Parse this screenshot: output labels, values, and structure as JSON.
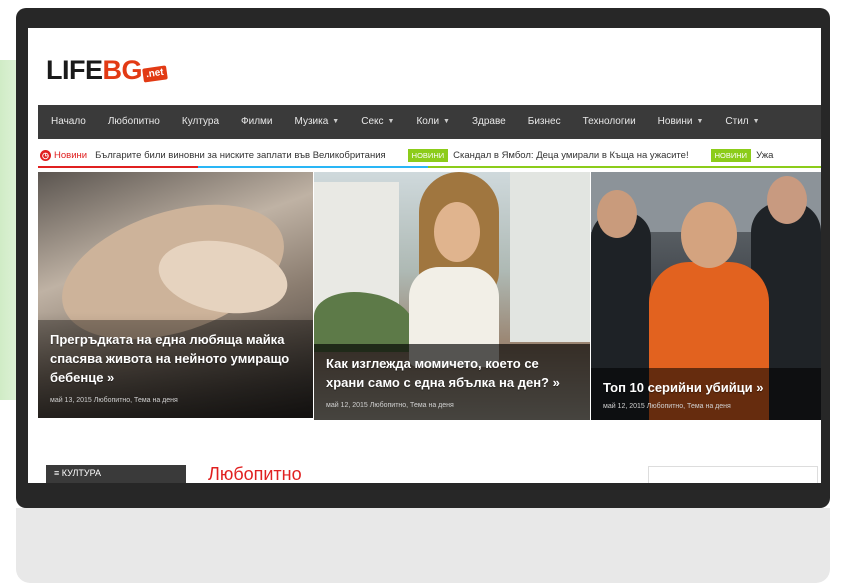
{
  "site": {
    "logo_main": "LIFE",
    "logo_accent": "BG",
    "logo_badge": ".net"
  },
  "nav": {
    "items": [
      {
        "label": "Начало",
        "dropdown": false
      },
      {
        "label": "Любопитно",
        "dropdown": false
      },
      {
        "label": "Култура",
        "dropdown": false
      },
      {
        "label": "Филми",
        "dropdown": false
      },
      {
        "label": "Музика",
        "dropdown": true
      },
      {
        "label": "Секс",
        "dropdown": true
      },
      {
        "label": "Коли",
        "dropdown": true
      },
      {
        "label": "Здраве",
        "dropdown": false
      },
      {
        "label": "Бизнес",
        "dropdown": false
      },
      {
        "label": "Технологии",
        "dropdown": false
      },
      {
        "label": "Новини",
        "dropdown": true
      },
      {
        "label": "Стил",
        "dropdown": true
      }
    ]
  },
  "ticker": {
    "label": "Новини",
    "items": [
      {
        "tag": "",
        "text": "Българите били виновни за ниските заплати във Великобритания"
      },
      {
        "tag": "НОВИНИ",
        "text": "Скандал в Ямбол: Деца умирали в Къща на ужасите!"
      },
      {
        "tag": "НОВИНИ",
        "text": "Ужа"
      }
    ]
  },
  "slides": [
    {
      "title": "Прегръдката на една любяща майка спасява живота на нейното умиращо бебенце »",
      "meta": "май 13, 2015   Любопитно, Тема на деня"
    },
    {
      "title": "Как изглежда момичето, което се храни само с една ябълка на ден? »",
      "meta": "май 12, 2015   Любопитно, Тема на деня"
    },
    {
      "title": "Топ 10 серийни убийци »",
      "meta": "май 12, 2015   Любопитно, Тема на деня"
    }
  ],
  "lower": {
    "category_box": "≡ КУЛТУРА",
    "section_title": "Любопитно"
  },
  "colors": {
    "nav_bg": "#3a3a3a",
    "accent_red": "#e23a14",
    "tag_green": "#8ccc1a",
    "monitor_frame": "#272727"
  }
}
